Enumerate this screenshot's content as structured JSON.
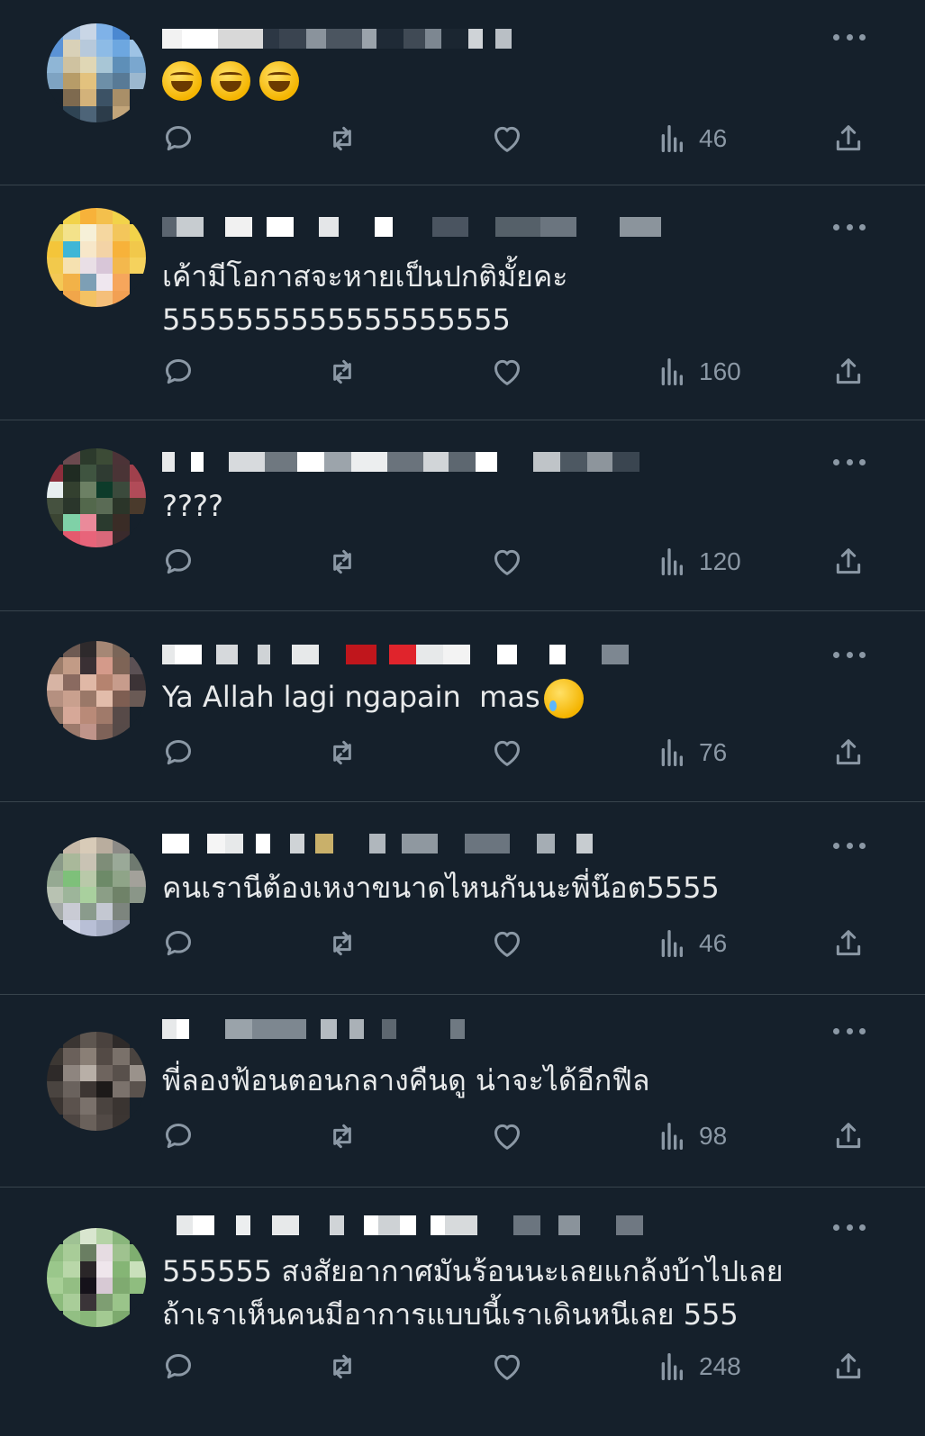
{
  "colors": {
    "background": "#15202b",
    "divider": "#38444d",
    "text": "#e7e9ea",
    "muted": "#8b98a5"
  },
  "icons": {
    "reply": "reply-icon",
    "retweet": "retweet-icon",
    "like": "heart-icon",
    "views": "views-icon",
    "share": "share-icon",
    "more": "more-icon"
  },
  "posts": [
    {
      "text": "😂😂😂",
      "views": "46"
    },
    {
      "text": "เค้ามีโอกาสจะหายเป็นปกติมั้ยคะ\n5555555555555555555",
      "views": "160"
    },
    {
      "text": "????",
      "views": "120"
    },
    {
      "text": "Ya Allah lagi ngapain  mas",
      "views": "76"
    },
    {
      "text": "คนเรานีต้องเหงาขนาดไหนกันนะพี่น๊อต5555",
      "views": "46"
    },
    {
      "text": "พี่ลองฟ้อนตอนกลางคืนดู น่าจะได้อีกฟีล",
      "views": "98"
    },
    {
      "text": "555555 สงสัยอากาศมันร้อนนะเลยแกล้งบ้าไปเลย\nถ้าเราเห็นคนมีอาการแบบนี้เราเดินหนีเลย 555",
      "views": "248"
    }
  ]
}
